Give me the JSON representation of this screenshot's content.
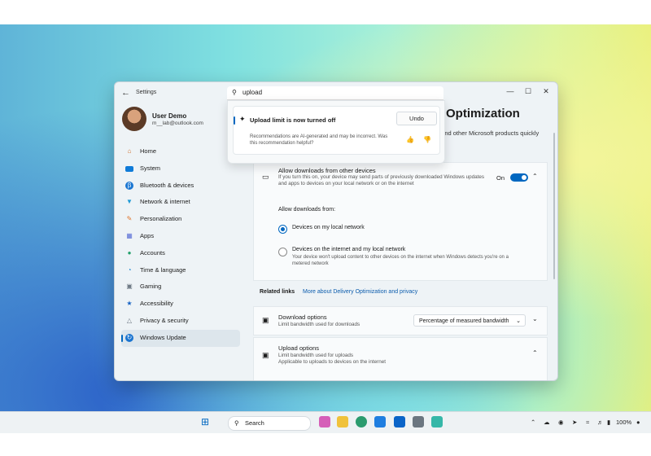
{
  "window": {
    "title": "Settings"
  },
  "profile": {
    "name": "User Demo",
    "email": "m__lab@outlook.com"
  },
  "nav": [
    {
      "label": "Home",
      "icon": "home-icon",
      "color": "#d1702e"
    },
    {
      "label": "System",
      "icon": "system-icon",
      "color": "#0f7bd8"
    },
    {
      "label": "Bluetooth & devices",
      "icon": "bluetooth-icon",
      "color": "#1a76d2"
    },
    {
      "label": "Network & internet",
      "icon": "wifi-icon",
      "color": "#1f9ad6"
    },
    {
      "label": "Personalization",
      "icon": "brush-icon",
      "color": "#e0742c"
    },
    {
      "label": "Apps",
      "icon": "apps-icon",
      "color": "#5a6fd6"
    },
    {
      "label": "Accounts",
      "icon": "person-icon",
      "color": "#22a06b"
    },
    {
      "label": "Time & language",
      "icon": "globe-icon",
      "color": "#1b86d1"
    },
    {
      "label": "Gaming",
      "icon": "gamepad-icon",
      "color": "#6f7a85"
    },
    {
      "label": "Accessibility",
      "icon": "accessibility-icon",
      "color": "#1662c4"
    },
    {
      "label": "Privacy & security",
      "icon": "shield-icon",
      "color": "#6c7680"
    },
    {
      "label": "Windows Update",
      "icon": "update-icon",
      "color": "#1a74d0"
    }
  ],
  "page": {
    "title": "Optimization",
    "subtitle": ", and other Microsoft products quickly"
  },
  "allow": {
    "title": "Allow downloads from other devices",
    "desc1": "If you turn this on, your device may send parts of previously downloaded Windows updates",
    "desc2": "and apps to devices on your local network or on the internet",
    "toggle_label": "On",
    "toggle_on": true
  },
  "allow_from": {
    "heading": "Allow downloads from:",
    "opt1": "Devices on my local network",
    "opt2": "Devices on the internet and my local network",
    "opt2_desc1": "Your device won't upload content to other devices on the internet when Windows detects you're on a",
    "opt2_desc2": "metered network",
    "selected": 0
  },
  "related": {
    "label": "Related links",
    "link": "More about Delivery Optimization and privacy"
  },
  "download": {
    "title": "Download options",
    "desc": "Limit bandwidth used for downloads",
    "dropdown": "Percentage of measured bandwidth"
  },
  "upload": {
    "title": "Upload options",
    "desc1": "Limit bandwidth used for uploads",
    "desc2": "Applicable to uploads to devices on the internet"
  },
  "search": {
    "value": "upload"
  },
  "notice": {
    "title": "Upload limit is now turned off",
    "undo": "Undo",
    "disclaimer1": "Recommendations are AI-generated and may be incorrect. Was",
    "disclaimer2": "this recommendation helpful?"
  },
  "taskbar": {
    "search_label": "Search",
    "battery": "100%",
    "accent": "#0067c0"
  }
}
